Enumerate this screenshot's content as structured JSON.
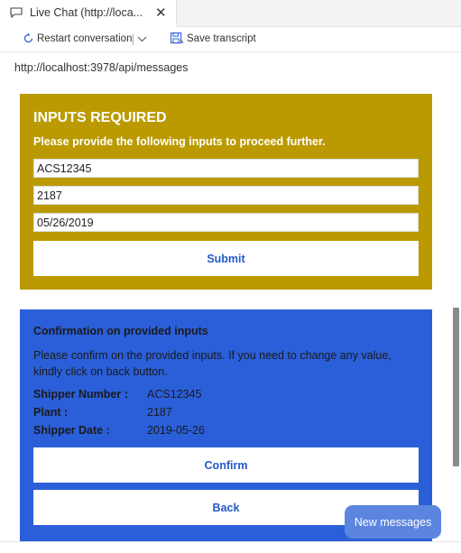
{
  "tab": {
    "title": "Live Chat (http://loca...",
    "icon": "chat-bubble-icon",
    "close_label": "✕"
  },
  "toolbar": {
    "restart_label": "Restart conversation",
    "save_label": "Save transcript"
  },
  "endpoint": "http://localhost:3978/api/messages",
  "inputs_card": {
    "title": "INPUTS REQUIRED",
    "subtitle": "Please provide the following inputs to proceed further.",
    "fields": [
      "ACS12345",
      "2187",
      "05/26/2019"
    ],
    "submit_label": "Submit",
    "color": "#ba9a00"
  },
  "confirm_card": {
    "title": "Confirmation on provided inputs",
    "description": "Please confirm on the provided inputs. If you need to change any value, kindly click on back button.",
    "facts": [
      {
        "key": "Shipper Number :",
        "value": "ACS12345"
      },
      {
        "key": "Plant :",
        "value": "2187"
      },
      {
        "key": "Shipper Date :",
        "value": "2019-05-26"
      }
    ],
    "confirm_label": "Confirm",
    "back_label": "Back",
    "color": "#2b5fd9"
  },
  "new_messages_label": "New messages",
  "accent_text_color": "#2458c8"
}
